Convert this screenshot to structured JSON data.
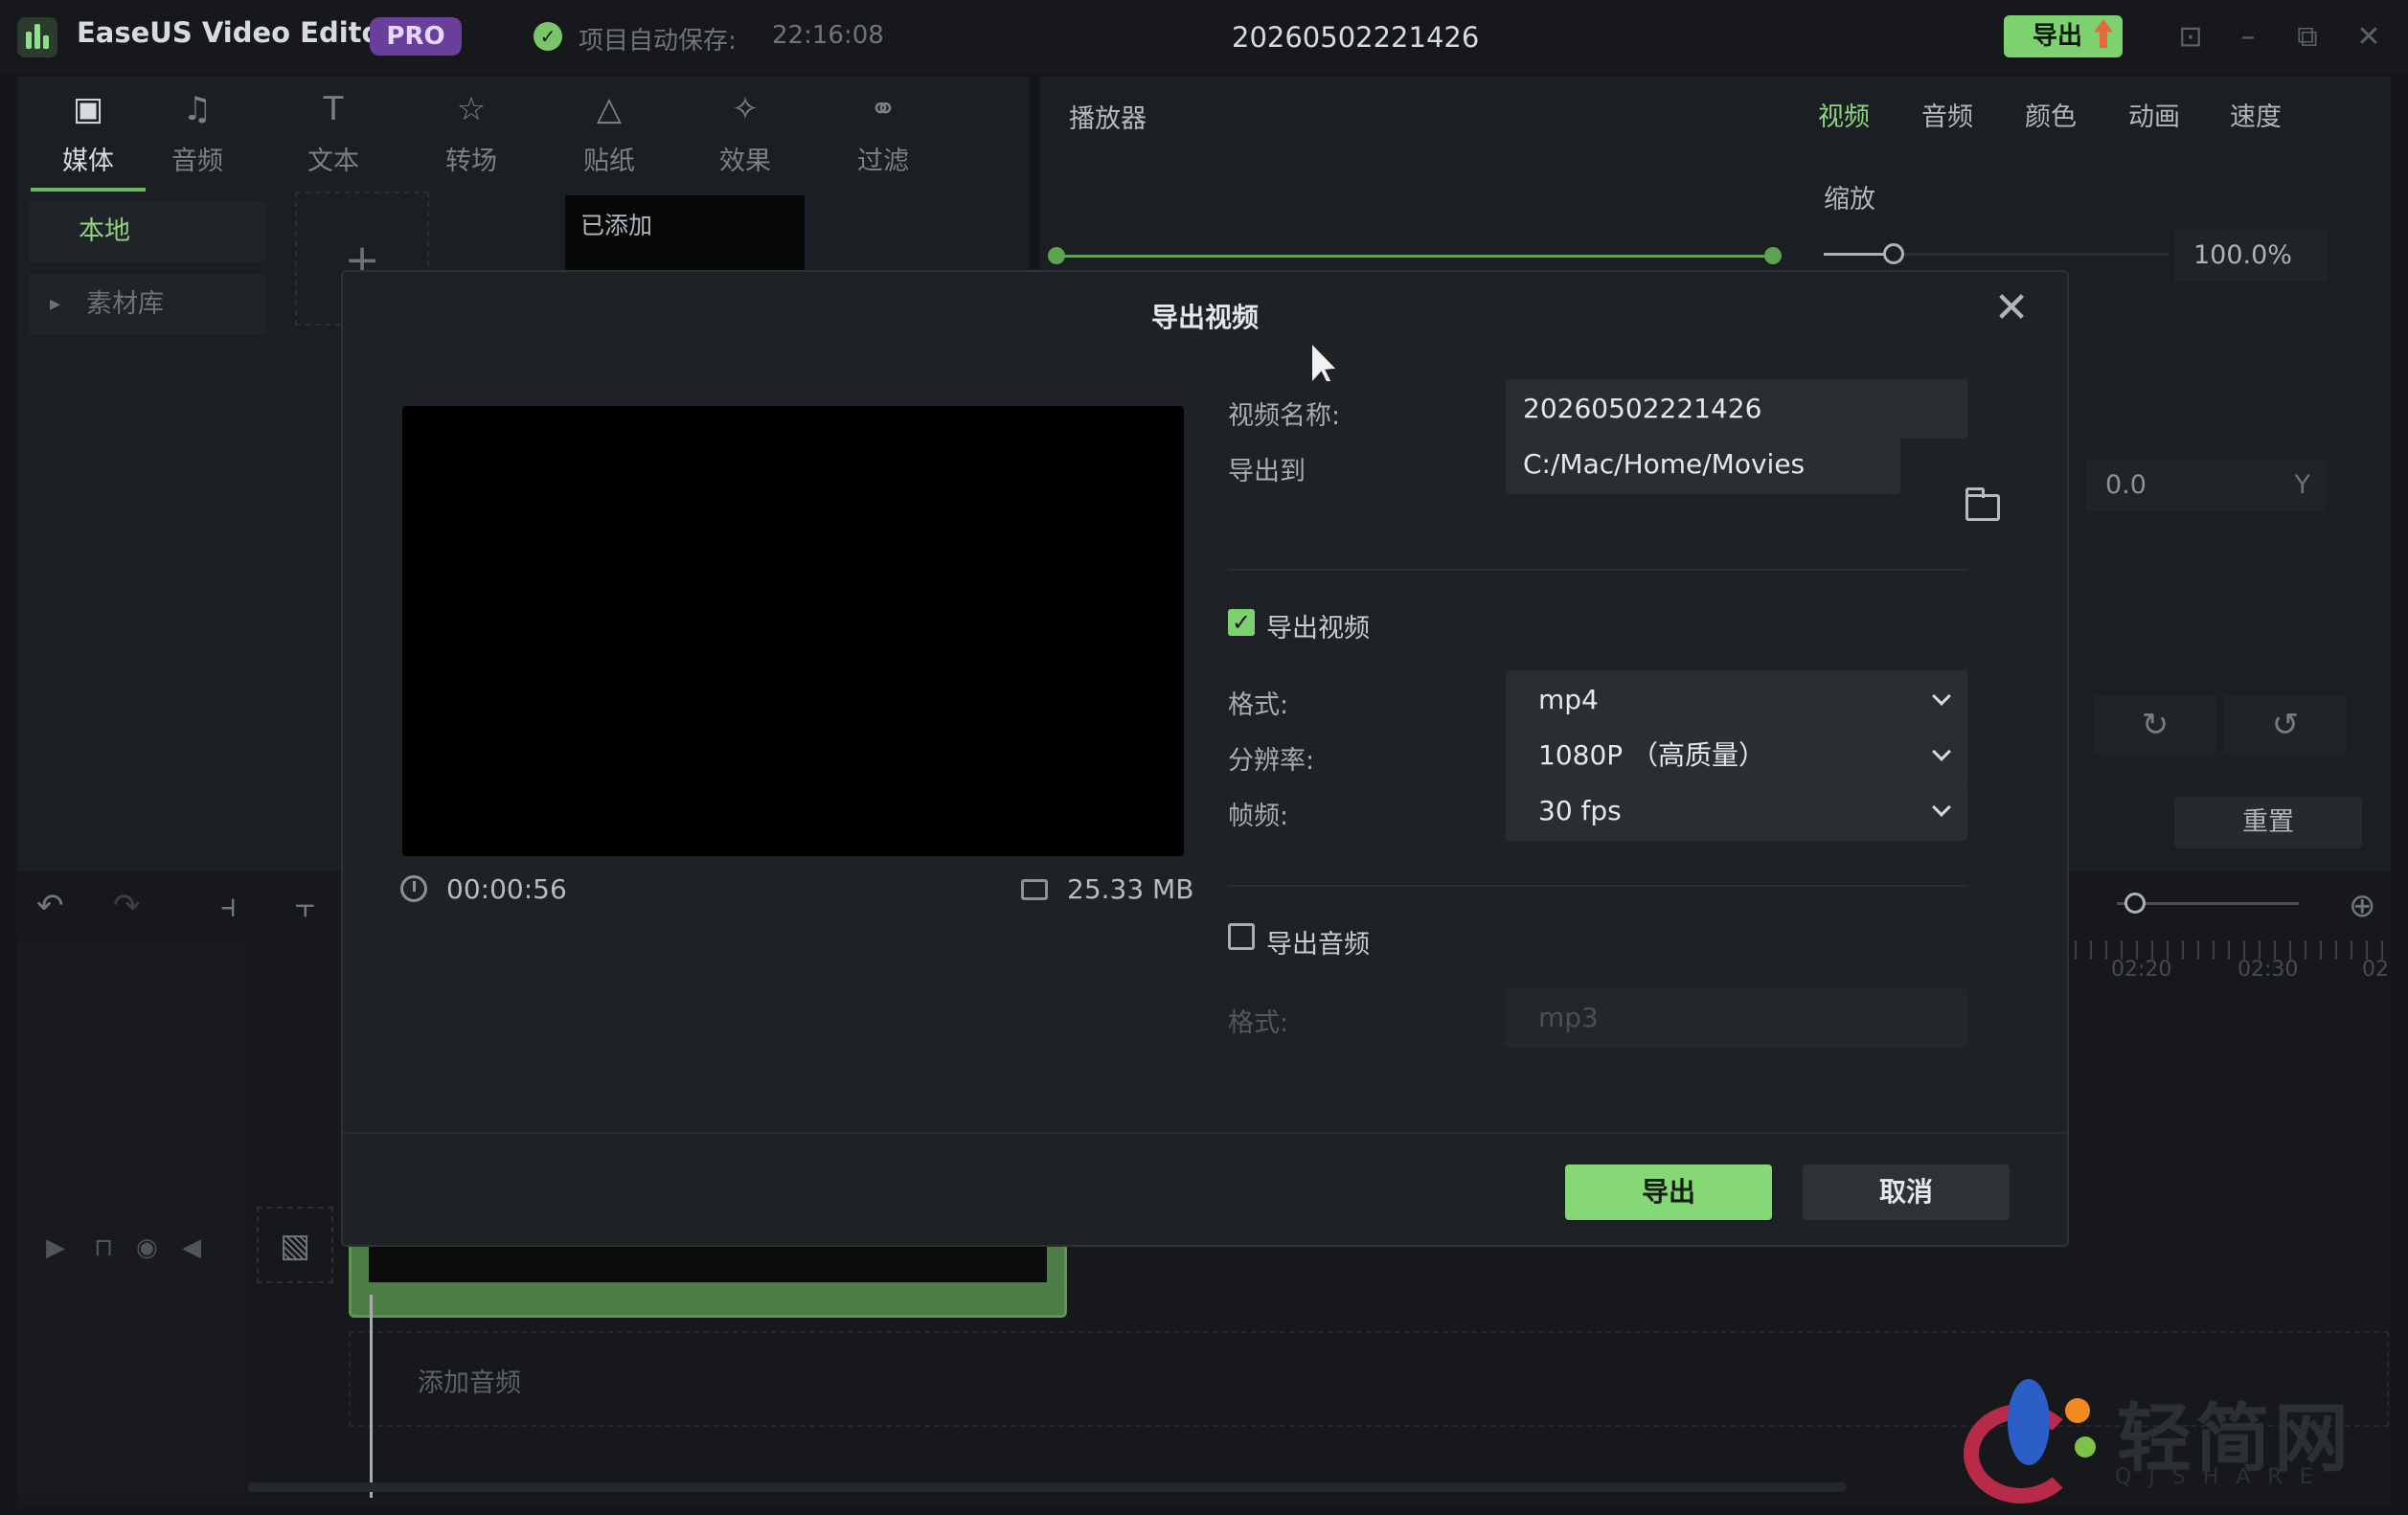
{
  "titlebar": {
    "app_name": "EaseUS Video Editor",
    "badge": "PRO",
    "autosave_label": "项目自动保存:",
    "autosave_time": "22:16:08",
    "project_name": "20260502221426",
    "export_label": "导出"
  },
  "tool_tabs": [
    {
      "label": "媒体",
      "icon": "media-icon"
    },
    {
      "label": "音频",
      "icon": "audio-icon"
    },
    {
      "label": "文本",
      "icon": "text-icon"
    },
    {
      "label": "转场",
      "icon": "transition-icon"
    },
    {
      "label": "贴纸",
      "icon": "sticker-icon"
    },
    {
      "label": "效果",
      "icon": "effect-icon"
    },
    {
      "label": "过滤",
      "icon": "filter-icon"
    }
  ],
  "media_sidebar": {
    "local": "本地",
    "library": "素材库",
    "added": "已添加"
  },
  "player": {
    "title": "播放器"
  },
  "props": {
    "tabs": [
      "视频",
      "音频",
      "颜色",
      "动画",
      "速度"
    ],
    "scale_label": "缩放",
    "scale_value": "100.0%",
    "pos_value": "0.0",
    "pos_axis": "Y",
    "reset_label": "重置"
  },
  "timeline": {
    "add_audio": "添加音频",
    "ruler": [
      "02:20",
      "02:30",
      "02"
    ]
  },
  "watermark": {
    "text": "轻简网",
    "sub": "QJSHARE"
  },
  "modal": {
    "title": "导出视频",
    "duration": "00:00:56",
    "file_size": "25.33 MB",
    "name_label": "视频名称:",
    "name_value": "20260502221426",
    "path_label": "导出到",
    "path_value": "C:/Mac/Home/Movies",
    "export_video_label": "导出视频",
    "export_video_checked": true,
    "format_label": "格式:",
    "format_value": "mp4",
    "resolution_label": "分辨率:",
    "resolution_value": "1080P （高质量）",
    "fps_label": "帧频:",
    "fps_value": "30 fps",
    "export_audio_label": "导出音频",
    "export_audio_checked": false,
    "audio_format_label": "格式:",
    "audio_format_value": "mp3",
    "export_button": "导出",
    "cancel_button": "取消"
  },
  "colors": {
    "accent": "#7ed16f",
    "pro": "#6a3f9c",
    "modal_bg": "#1e2125"
  }
}
